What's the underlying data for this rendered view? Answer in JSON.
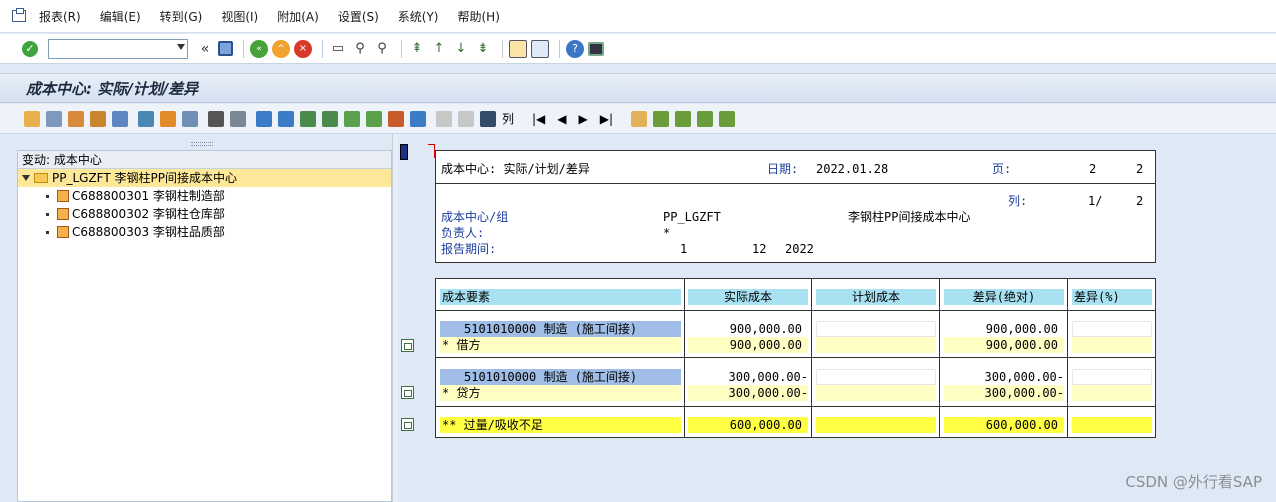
{
  "menu": {
    "items": [
      "报表(R)",
      "编辑(E)",
      "转到(G)",
      "视图(I)",
      "附加(A)",
      "设置(S)",
      "系统(Y)",
      "帮助(H)"
    ]
  },
  "command": {
    "value": "",
    "placeholder": ""
  },
  "title": "成本中心: 实际/计划/差异",
  "toolbar2": {
    "list_label": "列"
  },
  "tree": {
    "header": "变动:  成本中心",
    "root": "PP_LGZFT 李钢柱PP间接成本中心",
    "children": [
      "C688800301 李钢柱制造部",
      "C688800302 李钢柱仓库部",
      "C688800303 李钢柱品质部"
    ]
  },
  "report": {
    "header_title": "成本中心: 实际/计划/差异",
    "date_label": "日期:",
    "date_value": "2022.01.28",
    "page_label": "页:",
    "page_current": "2",
    "page_total": "2",
    "col_label": "列:",
    "col_value": "1/",
    "col_total": "2",
    "cc_group_label": "成本中心/组",
    "cc_group_value": "PP_LGZFT",
    "cc_group_desc": "李钢柱PP间接成本中心",
    "owner_label": "负责人:",
    "owner_value": "*",
    "period_label": "报告期间:",
    "period_from": "1",
    "period_to": "12",
    "period_year": "2022"
  },
  "table": {
    "columns": [
      "成本要素",
      "实际成本",
      "计划成本",
      "差异(绝对)",
      "差异(%)"
    ],
    "groups": [
      {
        "element": "5101010000 制造 (施工间接)",
        "element_actual": "900,000.00",
        "element_plan": "",
        "element_var": "900,000.00",
        "element_pct": "",
        "sum_label": "*  借方",
        "sum_actual": "900,000.00",
        "sum_plan": "",
        "sum_var": "900,000.00",
        "sum_pct": ""
      },
      {
        "element": "5101010000 制造 (施工间接)",
        "element_actual": "300,000.00-",
        "element_plan": "",
        "element_var": "300,000.00-",
        "element_pct": "",
        "sum_label": "*  贷方",
        "sum_actual": "300,000.00-",
        "sum_plan": "",
        "sum_var": "300,000.00-",
        "sum_pct": ""
      }
    ],
    "total": {
      "label": "** 过量/吸收不足",
      "actual": "600,000.00",
      "plan": "",
      "var": "600,000.00",
      "pct": ""
    }
  },
  "watermark": "CSDN @外行看SAP"
}
